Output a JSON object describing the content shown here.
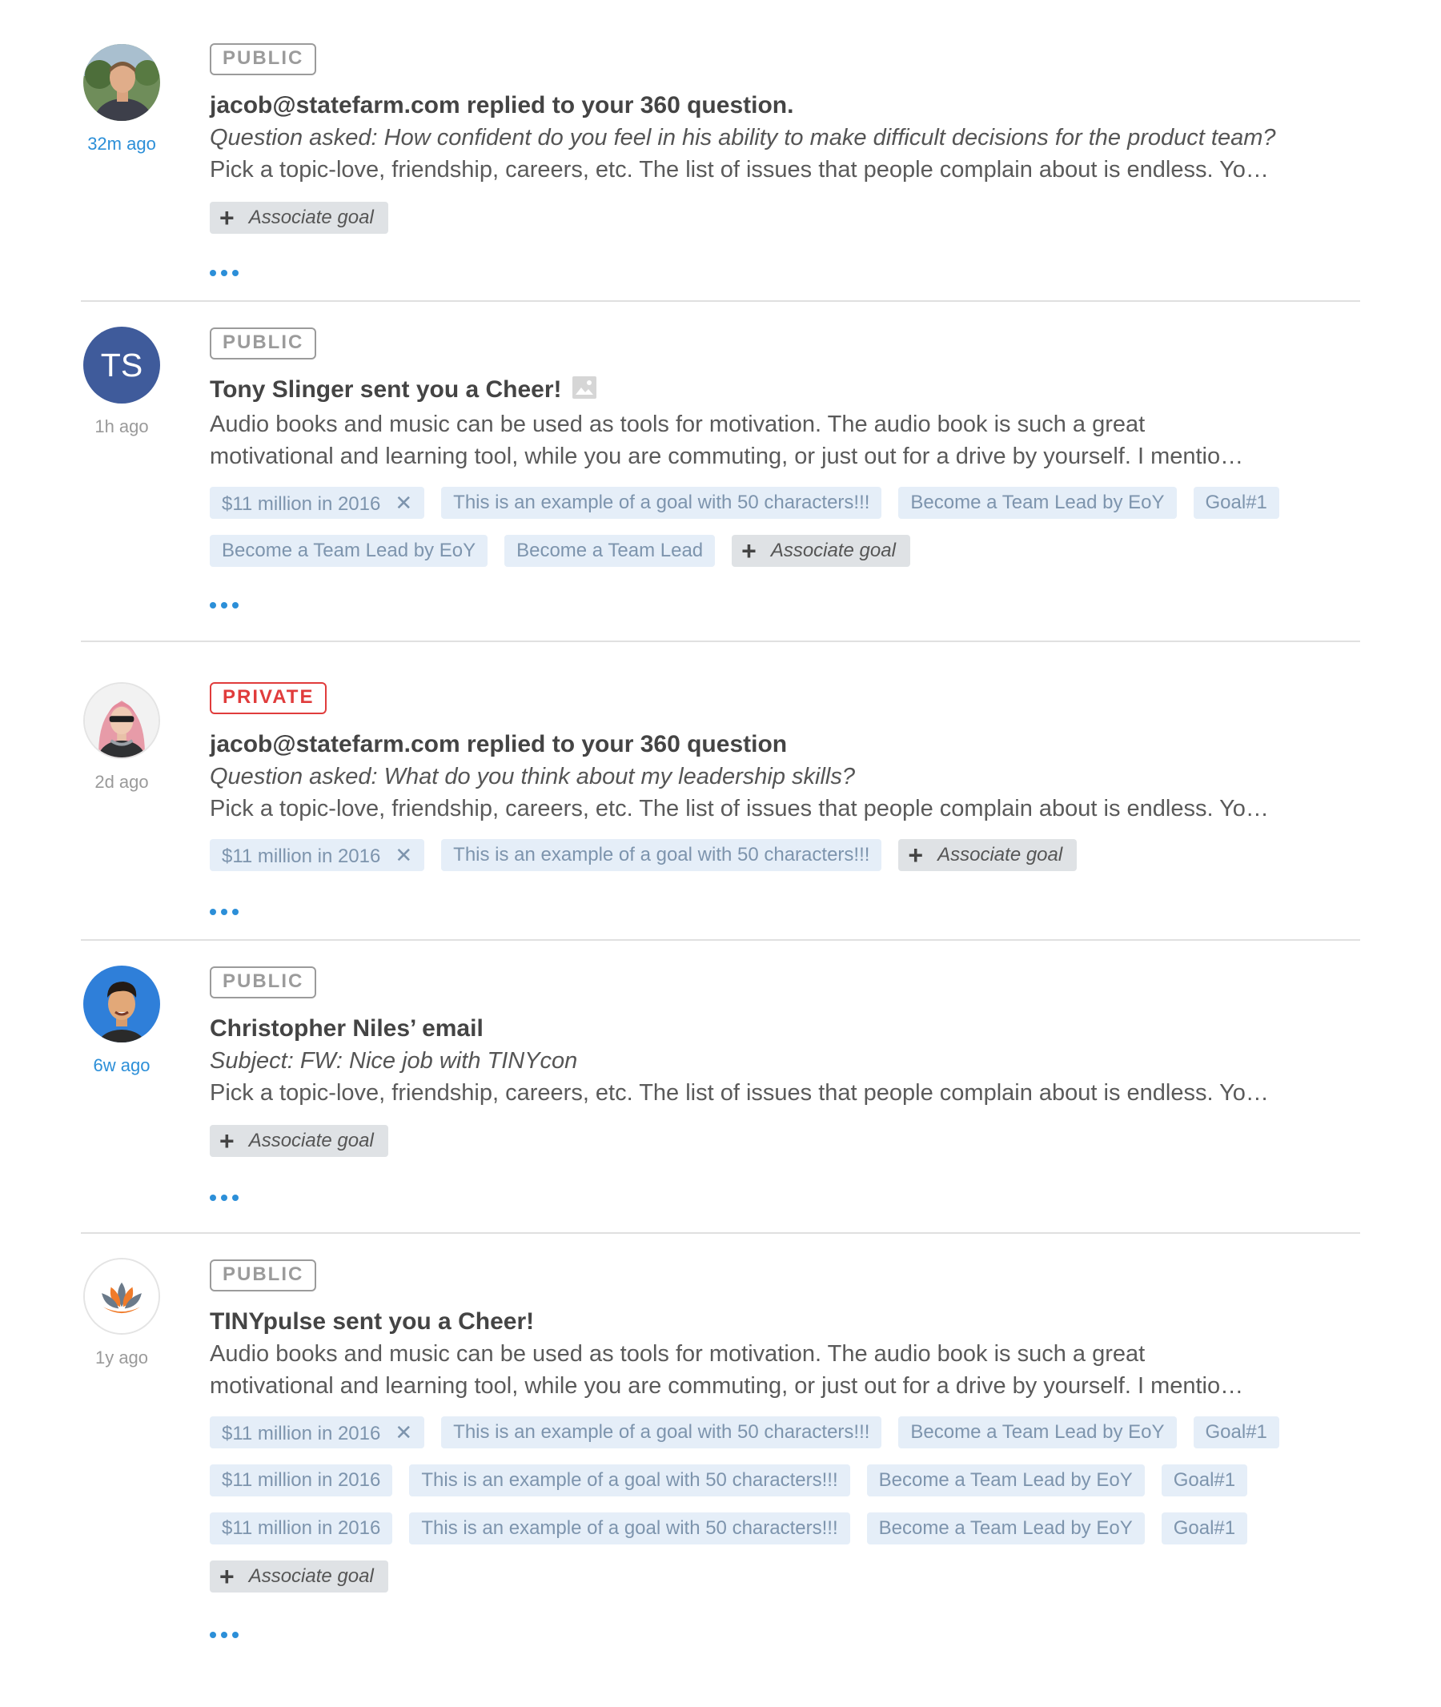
{
  "colors": {
    "accent": "#2c8fd8",
    "private": "#e03c3c",
    "chip_bg": "#e5eef8",
    "chip_text": "#7d94ad",
    "assoc_bg": "#dfe2e5",
    "initials_bg": "#3f5b9b"
  },
  "feed": {
    "items": [
      {
        "avatar": "photo-man",
        "time": "32m ago",
        "visibility": "PUBLIC",
        "title": "jacob@statefarm.com replied to your 360 question.",
        "subtitle": "Question asked: How confident do you feel in his ability to make difficult decisions for the product team?",
        "body": "Pick a topic-love, friendship, careers, etc. The list of issues that people complain about is endless. Yo…",
        "associate_label": "Associate goal"
      },
      {
        "avatar_initials": "TS",
        "time": "1h ago",
        "visibility": "PUBLIC",
        "title": "Tony Slinger sent you a Cheer!",
        "body_line1": "Audio books and music can be used as tools for motivation. The audio book is such a great",
        "body_line2": "motivational and learning tool, while you are commuting, or just out for a drive by yourself. I mentio…",
        "goals": [
          "$11 million in 2016",
          "This is an example of a goal with 50 characters!!!",
          "Become a Team Lead by EoY",
          "Goal#1",
          "Become a Team Lead by EoY",
          "Become a Team Lead"
        ],
        "associate_label": "Associate goal"
      },
      {
        "avatar": "photo-woman",
        "time": "2d ago",
        "visibility": "PRIVATE",
        "title": "jacob@statefarm.com replied to your 360 question",
        "subtitle": "Question asked: What do you think about my leadership skills?",
        "body": "Pick a topic-love, friendship, careers, etc. The list of issues that people complain about is endless. Yo…",
        "goals": [
          "$11 million in 2016",
          "This is an example of a goal with 50 characters!!!"
        ],
        "associate_label": "Associate goal"
      },
      {
        "avatar": "photo-man-blue",
        "time": "6w ago",
        "visibility": "PUBLIC",
        "title": "Christopher Niles’ email",
        "subtitle": "Subject: FW: Nice job with TINYcon",
        "body": "Pick a topic-love, friendship, careers, etc. The list of issues that people complain about is endless. Yo…",
        "associate_label": "Associate goal"
      },
      {
        "avatar": "tinypulse-logo",
        "time": "1y ago",
        "visibility": "PUBLIC",
        "title": "TINYpulse sent you a Cheer!",
        "body_line1": "Audio books and music can be used as tools for motivation. The audio book is such a great",
        "body_line2": "motivational and learning tool, while you are commuting, or just out for a drive by yourself. I mentio…",
        "goals": [
          "$11 million in 2016",
          "This is an example of a goal with 50 characters!!!",
          "Become a Team Lead by EoY",
          "Goal#1",
          "$11 million in 2016",
          "This is an example of a goal with 50 characters!!!",
          "Become a Team Lead by EoY",
          "Goal#1",
          "$11 million in 2016",
          "This is an example of a goal with 50 characters!!!",
          "Become a Team Lead by EoY",
          "Goal#1"
        ],
        "associate_label": "Associate goal"
      }
    ]
  },
  "icons": {
    "remove": "close-icon",
    "add": "plus-icon",
    "more": "more-dots-icon",
    "image": "image-icon"
  }
}
